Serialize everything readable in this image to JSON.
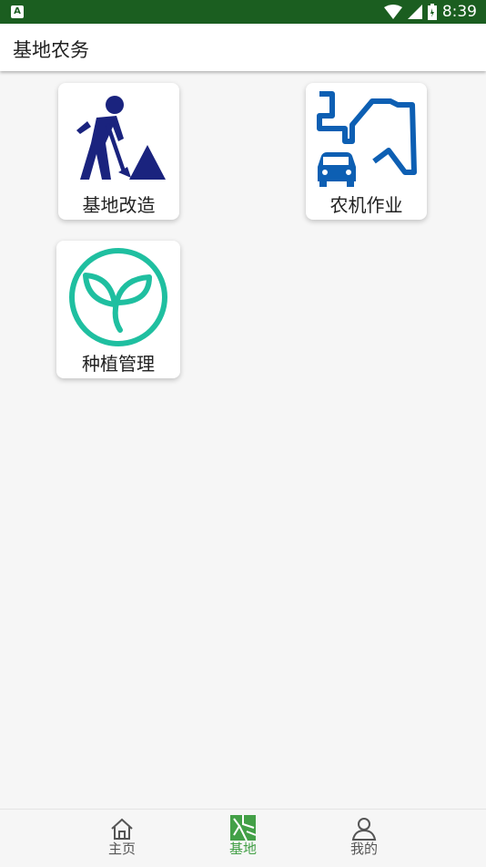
{
  "status_bar": {
    "time": "8:39",
    "icons": [
      "app-a-icon",
      "wifi-icon",
      "signal-icon",
      "battery-charging-icon"
    ]
  },
  "app_bar": {
    "title": "基地农务"
  },
  "menu": {
    "items": [
      {
        "label": "基地改造",
        "icon": "worker-digging-icon",
        "color": "#1a237e"
      },
      {
        "label": "农机作业",
        "icon": "tractor-field-icon",
        "color": "#0d5fb3"
      },
      {
        "label": "种植管理",
        "icon": "sprout-icon",
        "color": "#1fbfa0"
      }
    ]
  },
  "bottom_nav": {
    "items": [
      {
        "label": "主页",
        "icon": "home-icon",
        "active": false
      },
      {
        "label": "基地",
        "icon": "base-map-icon",
        "active": true
      },
      {
        "label": "我的",
        "icon": "user-icon",
        "active": false
      }
    ],
    "active_color": "#43a047"
  }
}
